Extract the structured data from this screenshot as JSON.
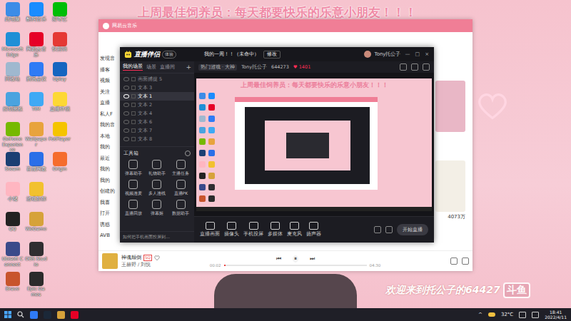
{
  "wallpaper": {
    "banner": "上周最佳饲养员：每天都要快乐的乐意小朋友！！！",
    "watermark": "欢迎来到托公子的64427",
    "watermark_logo": "斗鱼"
  },
  "desktop_icons": [
    {
      "label": "此电脑",
      "color": "#3c8ce7"
    },
    {
      "label": "Microsoft Edge",
      "color": "#1f8fd6"
    },
    {
      "label": "回收站",
      "color": "#9fb8cf"
    },
    {
      "label": "控制面板",
      "color": "#4aa3df"
    },
    {
      "label": "GeForce Experience",
      "color": "#76b900"
    },
    {
      "label": "Steam",
      "color": "#1b3f73"
    },
    {
      "label": "小猪",
      "color": "#ffb6c1"
    },
    {
      "label": "QQ",
      "color": "#222222"
    },
    {
      "label": "Ubisoft Connect",
      "color": "#3a4a8a"
    },
    {
      "label": "Brave",
      "color": "#c8542c"
    },
    {
      "label": "酷狗音乐",
      "color": "#1a8cff"
    },
    {
      "label": "网易云音乐",
      "color": "#e60026"
    },
    {
      "label": "腾讯会议",
      "color": "#2f7bf5"
    },
    {
      "label": "TIM",
      "color": "#3fa9f5"
    },
    {
      "label": "Wallpaper",
      "color": "#e8a33d"
    },
    {
      "label": "百度网盘",
      "color": "#2a6fe8"
    },
    {
      "label": "游戏加加",
      "color": "#f2c12e"
    },
    {
      "label": "WeGame",
      "color": "#d6a23a"
    },
    {
      "label": "OBS Studio",
      "color": "#302e31"
    },
    {
      "label": "Epic Games",
      "color": "#2b2b2b"
    },
    {
      "label": "爱奇艺",
      "color": "#00be06"
    },
    {
      "label": "快剪辑",
      "color": "#e53935"
    },
    {
      "label": "Uplay",
      "color": "#1565c0"
    },
    {
      "label": "直播伴侣",
      "color": "#fdd835"
    },
    {
      "label": "PotPlayer",
      "color": "#f5c400"
    },
    {
      "label": "Origin",
      "color": "#f56c2d"
    }
  ],
  "music_window": {
    "title": "网易云音乐",
    "sidebar": [
      "发现音",
      "播客",
      "视频",
      "关注",
      "直播",
      "私人F",
      "我的音",
      "本地",
      "我的",
      "最近",
      "我的",
      "我的",
      "创建的",
      "我喜",
      "打开",
      "诱惑",
      "AVB"
    ],
    "cards": [
      {
        "color": "#e9b7c6"
      },
      {
        "color": "#f3efe6"
      }
    ],
    "play_count": "4073万",
    "song": {
      "title": "神魂颠倒",
      "tag": "SQ",
      "artist": "王赫野 / 刘悦",
      "elapsed": "00:02",
      "duration": "04:30",
      "playing": true,
      "level": 0.01
    },
    "controls": [
      "⏮",
      "⏸",
      "⏭"
    ]
  },
  "live_window": {
    "title": "直播伴侣",
    "badge": "体验",
    "room_title": "我的一周！！（未命中）",
    "edit_button": "修改",
    "user": "Tony托公子",
    "window_buttons": [
      "—",
      "□",
      "×"
    ],
    "tabs": [
      {
        "label": "我的场景",
        "selected": true
      },
      {
        "label": "场景",
        "selected": false
      },
      {
        "label": "直播间",
        "selected": false
      }
    ],
    "add_button": "+",
    "scenes": [
      {
        "name": "画面捕捉 5",
        "selected": false
      },
      {
        "name": "文本 3",
        "selected": false
      },
      {
        "name": "文本 1",
        "selected": true
      },
      {
        "name": "文本 2",
        "selected": false
      },
      {
        "name": "文本 4",
        "selected": false
      },
      {
        "name": "文本 6",
        "selected": false
      },
      {
        "name": "文本 7",
        "selected": false
      },
      {
        "name": "文本 8",
        "selected": false
      }
    ],
    "toolbox_title": "工具箱",
    "tools": [
      "弹幕助手",
      "礼物助手",
      "主播任务",
      "视频连麦",
      "多人连线",
      "直播PK",
      "直播回放",
      "弹幕姬",
      "数据助手"
    ],
    "hint": "如何把手机画面投屏到…",
    "info": {
      "category": "热门游戏 · 大神",
      "user": "Tony托公子",
      "room_id": "644273",
      "likes": "1401"
    },
    "toolbar": [
      "直播画面",
      "摄像头",
      "手机投屏",
      "多媒体",
      "麦克风",
      "扬声器"
    ],
    "start_button": "开始直播"
  },
  "preview": {
    "banner": "上周最佳饲养员：每天都要快乐的乐意小朋友！！！"
  },
  "taskbar": {
    "pinned": [
      {
        "color": "#2f7bf5"
      },
      {
        "color": "#1b2838"
      },
      {
        "color": "#d6a23a"
      },
      {
        "color": "#e60026"
      }
    ],
    "tray_arrow": "^",
    "temperature": "32°C",
    "time": "18:41",
    "date": "2022/4/11"
  }
}
